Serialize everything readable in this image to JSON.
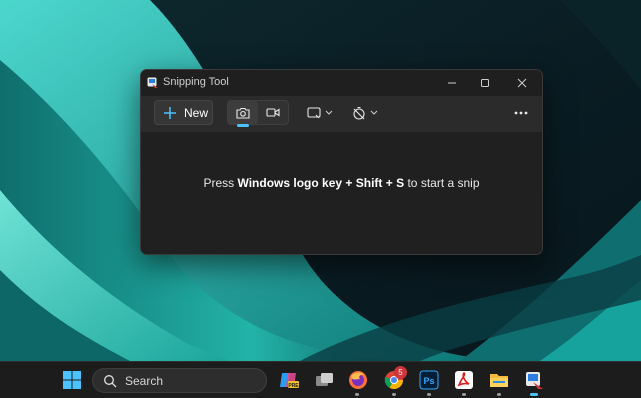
{
  "window": {
    "title": "Snipping Tool",
    "new_label": "New",
    "hint_prefix": "Press ",
    "hint_win": "Windows logo key",
    "hint_plus1": " + ",
    "hint_shift": "Shift",
    "hint_plus2": " + ",
    "hint_s": "S",
    "hint_suffix": " to start a snip",
    "modes": [
      {
        "icon": "camera-icon",
        "selected": true
      },
      {
        "icon": "video-camera-icon",
        "selected": false
      }
    ],
    "shape_icon": "rectangle-snip-icon",
    "delay_icon": "no-delay-timer-icon",
    "accent": "#4cc2ff"
  },
  "taskbar": {
    "search_label": "Search",
    "chrome_badge": "5",
    "apps": [
      {
        "icon": "start-windows-icon"
      },
      {
        "icon": "copilot-pre-icon"
      },
      {
        "icon": "task-view-icon"
      },
      {
        "icon": "firefox-icon"
      },
      {
        "icon": "chrome-icon"
      },
      {
        "icon": "photoshop-icon"
      },
      {
        "icon": "acrobat-icon"
      },
      {
        "icon": "file-explorer-icon"
      },
      {
        "icon": "snipping-tool-icon"
      }
    ]
  }
}
